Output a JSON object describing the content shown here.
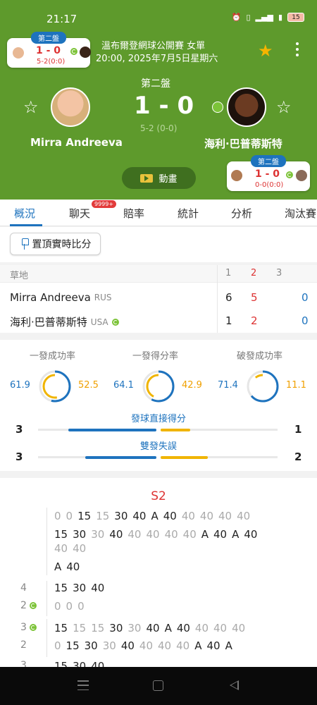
{
  "status_bar": {
    "time": "21:17",
    "icons": [
      "alarm-off-icon",
      "vibrate-icon",
      "signal-icon",
      "wifi-icon"
    ],
    "battery": "15"
  },
  "top_mini_card": {
    "tag": "第二盤",
    "score": "1 - 0",
    "sub": "5-2(0:0)"
  },
  "tournament": {
    "title": "溫布爾登網球公開賽 女單",
    "datetime": "20:00, 2025年7月5日星期六"
  },
  "match": {
    "set_label": "第二盤",
    "score": "1 - 0",
    "sub_score": "5-2 (0-0)",
    "player1": {
      "name": "Mirra Andreeva",
      "country": "RUS"
    },
    "player2": {
      "name": "海利·巴普蒂斯特",
      "country": "USA"
    }
  },
  "bottom_mini_card": {
    "tag": "第二盤",
    "score": "1 - 0",
    "sub": "0-0(0:0)"
  },
  "animation_button": {
    "label": "動畫"
  },
  "tabs": [
    {
      "label": "概況",
      "active": true
    },
    {
      "label": "聊天",
      "badge": "9999+"
    },
    {
      "label": "賠率"
    },
    {
      "label": "統計"
    },
    {
      "label": "分析"
    },
    {
      "label": "淘汰賽"
    }
  ],
  "pin_button": {
    "label": "置頂實時比分"
  },
  "score_table": {
    "surface": "草地",
    "columns": [
      "1",
      "2",
      "3"
    ],
    "rows": [
      {
        "name": "Mirra Andreeva",
        "country": "RUS",
        "sets": [
          "6",
          "5",
          "0"
        ]
      },
      {
        "name": "海利·巴普蒂斯特",
        "country": "USA",
        "sets": [
          "1",
          "2",
          "0"
        ]
      }
    ]
  },
  "stats": {
    "donuts": [
      {
        "title": "一發成功率",
        "left": "61.9",
        "right": "52.5"
      },
      {
        "title": "一發得分率",
        "left": "64.1",
        "right": "42.9"
      },
      {
        "title": "破發成功率",
        "left": "71.4",
        "right": "11.1"
      }
    ],
    "bars": [
      {
        "title": "發球直接得分",
        "left": "3",
        "right": "1"
      },
      {
        "title": "雙發失誤",
        "left": "3",
        "right": "2"
      }
    ]
  },
  "point_by_point": {
    "title": "S2",
    "games": [
      {
        "score": "",
        "lines": [
          [
            "0",
            "0",
            "15",
            "15",
            "30",
            "40",
            "A",
            "40",
            "40",
            "40",
            "40",
            "40"
          ],
          [
            "15",
            "30",
            "30",
            "40",
            "40",
            "40",
            "40",
            "40",
            "A",
            "40",
            "A",
            "40"
          ],
          [
            "40",
            "40"
          ],
          [
            "A",
            "40"
          ]
        ]
      },
      {
        "score": "4",
        "lines": [
          [
            "15",
            "30",
            "40"
          ]
        ]
      },
      {
        "score": "2",
        "serve": true,
        "lines": [
          [
            "0",
            "0",
            "0"
          ]
        ]
      },
      {
        "score": "3",
        "serve": true,
        "lines": [
          [
            "15",
            "15",
            "15",
            "30",
            "30",
            "40",
            "A",
            "40",
            "40",
            "40",
            "40"
          ]
        ]
      },
      {
        "score": "2",
        "lines": [
          [
            "0",
            "15",
            "30",
            "30",
            "40",
            "40",
            "40",
            "40",
            "A",
            "40",
            "A"
          ]
        ]
      },
      {
        "score": "3",
        "lines": [
          [
            "15",
            "30",
            "40"
          ]
        ]
      }
    ]
  },
  "colors": {
    "header_green": "#5e9a2c",
    "accent_blue": "#1e73be",
    "accent_red": "#dd3333",
    "accent_yellow": "#f0b400"
  }
}
